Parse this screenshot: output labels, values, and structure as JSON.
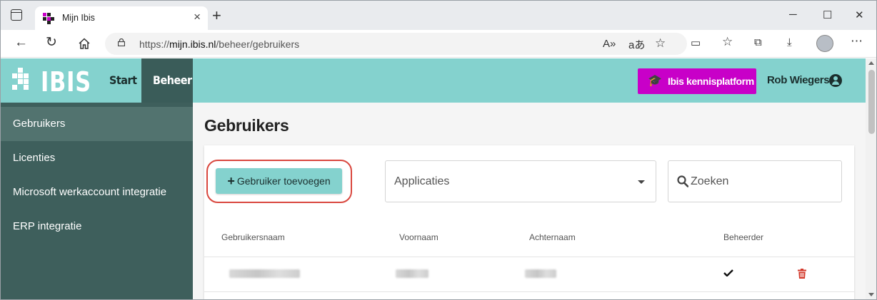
{
  "browser": {
    "tab_title": "Mijn Ibis",
    "url_prefix": "https://",
    "url_host": "mijn.ibis.nl",
    "url_path": "/beheer/gebruikers",
    "window_controls": {
      "minimize": "─",
      "maximize": "☐",
      "close": "✕"
    }
  },
  "topnav": {
    "logo_text": "IBIS",
    "links": [
      {
        "label": "Start",
        "active": false
      },
      {
        "label": "Beheer",
        "active": true
      }
    ],
    "kennis_button": "Ibis kennisplatform",
    "user_name": "Rob Wiegers"
  },
  "sidebar": {
    "items": [
      {
        "label": "Gebruikers",
        "active": true
      },
      {
        "label": "Licenties",
        "active": false
      },
      {
        "label": "Microsoft werkaccount integratie",
        "active": false
      },
      {
        "label": "ERP integratie",
        "active": false
      }
    ]
  },
  "main": {
    "title": "Gebruikers",
    "add_button": "Gebruiker toevoegen",
    "applications_placeholder": "Applicaties",
    "search_placeholder": "Zoeken",
    "columns": [
      "Gebruikersnaam",
      "Voornaam",
      "Achternaam",
      "Beheerder"
    ],
    "rows": [
      {
        "username_redacted": true,
        "firstname_redacted": true,
        "lastname_redacted": true,
        "is_admin": true
      }
    ]
  },
  "colors": {
    "teal": "#84d2ce",
    "sidebar": "#3e5f5c",
    "magenta": "#c800c8",
    "highlight_ring": "#d9473e",
    "trash": "#d33a2c"
  }
}
